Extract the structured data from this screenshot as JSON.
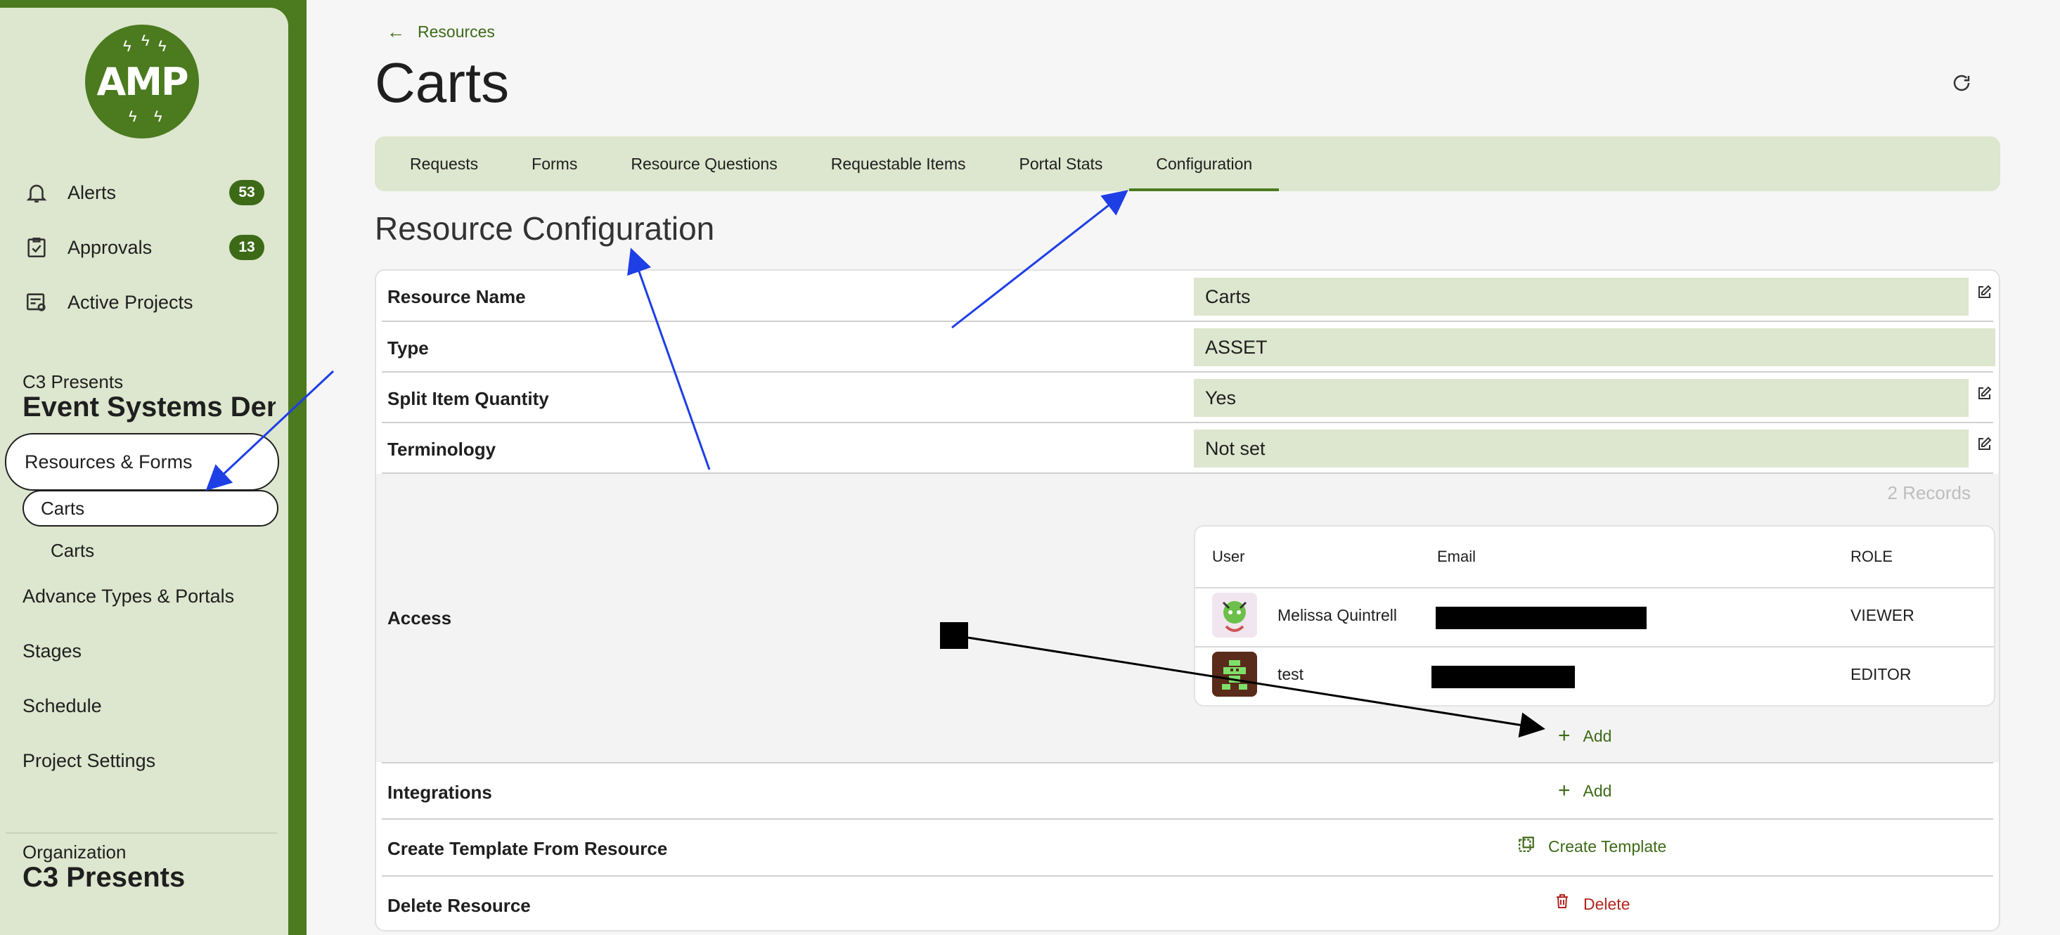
{
  "sidebar": {
    "logo": "AMP",
    "nav": [
      {
        "label": "Alerts",
        "badge": "53"
      },
      {
        "label": "Approvals",
        "badge": "13"
      },
      {
        "label": "Active Projects"
      }
    ],
    "project": {
      "org": "C3 Presents",
      "name": "Event Systems Den"
    },
    "resources_forms": "Resources & Forms",
    "carts_active": "Carts",
    "carts_sub": "Carts",
    "links": [
      "Advance Types & Portals",
      "Stages",
      "Schedule",
      "Project Settings"
    ],
    "organization": {
      "label": "Organization",
      "name": "C3 Presents"
    }
  },
  "breadcrumb": "Resources",
  "page_title": "Carts",
  "tabs": [
    "Requests",
    "Forms",
    "Resource Questions",
    "Requestable Items",
    "Portal Stats",
    "Configuration"
  ],
  "section_heading": "Resource Configuration",
  "config": {
    "resource_name": {
      "label": "Resource Name",
      "value": "Carts"
    },
    "type": {
      "label": "Type",
      "value": "ASSET"
    },
    "split": {
      "label": "Split Item Quantity",
      "value": "Yes"
    },
    "terminology": {
      "label": "Terminology",
      "value": "Not set"
    },
    "access": {
      "label": "Access",
      "records": "2 Records",
      "headers": {
        "user": "User",
        "email": "Email",
        "role": "ROLE"
      },
      "users": [
        {
          "name": "Melissa Quintrell",
          "role": "VIEWER"
        },
        {
          "name": "test",
          "role": "EDITOR"
        }
      ],
      "add": "Add"
    },
    "integrations": {
      "label": "Integrations",
      "add": "Add"
    },
    "template": {
      "label": "Create Template From Resource",
      "action": "Create Template"
    },
    "delete": {
      "label": "Delete Resource",
      "action": "Delete"
    }
  },
  "colors": {
    "brand": "#4b7a1f",
    "surface": "#dde6ce",
    "danger": "#b3261e"
  }
}
